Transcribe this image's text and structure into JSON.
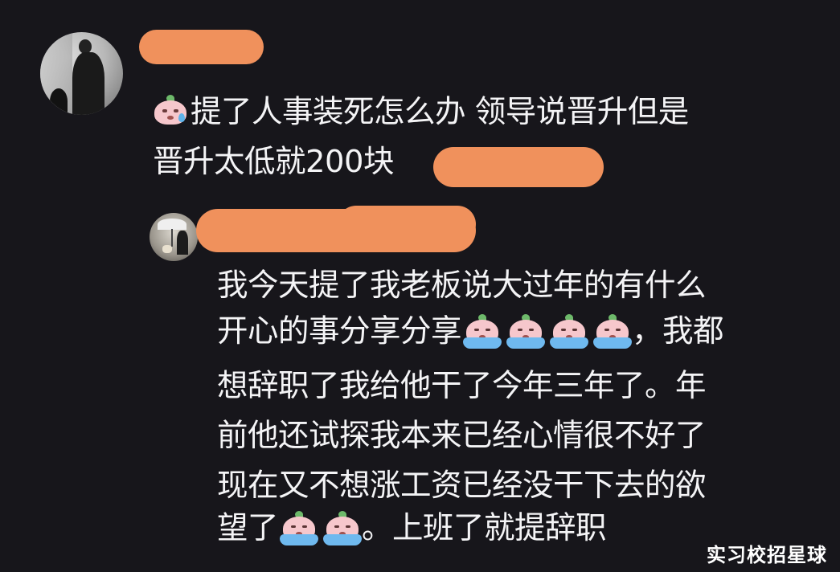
{
  "comment1": {
    "lines": [
      "提了人事装死怎么办 领导说晋升但是",
      "晋升太低就200块"
    ],
    "emoji_name": "sweat-face-emoji"
  },
  "reply1": {
    "lines": [
      "我今天提了我老板说大过年的有什么",
      "开心的事分享分享",
      "，我都",
      "想辞职了我给他干了今年三年了。年",
      "前他还试探我本来已经心情很不好了",
      "现在又不想涨工资已经没干下去的欲",
      "望了",
      "。上班了就提辞职"
    ],
    "emoji_name": "crying-face-emoji"
  },
  "watermark": "实习校招星球",
  "colors": {
    "background": "#17161b",
    "text": "#f4f4f6",
    "redaction": "#f0915c"
  }
}
